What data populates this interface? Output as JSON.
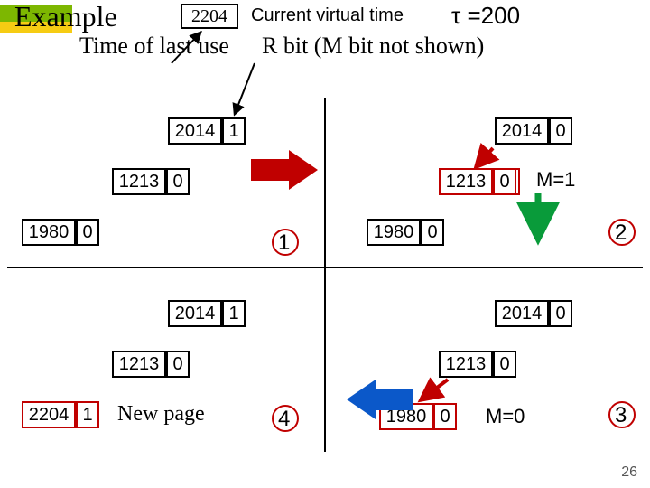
{
  "header": {
    "title": "Example",
    "box_value": "2204",
    "current_virtual_time": "Current virtual time",
    "tau": "τ =200",
    "time_of_last_use": "Time of last use",
    "r_bit": "R bit  (M bit not shown)"
  },
  "panels": {
    "p1": {
      "num": "1",
      "entries": [
        {
          "v": "2014",
          "b": "1"
        },
        {
          "v": "1213",
          "b": "0"
        },
        {
          "v": "1980",
          "b": "0"
        }
      ]
    },
    "p2": {
      "num": "2",
      "m": "M=1",
      "entries": [
        {
          "v": "2014",
          "b": "0"
        },
        {
          "v": "1213",
          "b": "0"
        },
        {
          "v": "1980",
          "b": "0"
        }
      ]
    },
    "p3": {
      "num": "3",
      "m": "M=0",
      "entries": [
        {
          "v": "2014",
          "b": "0"
        },
        {
          "v": "1213",
          "b": "0"
        },
        {
          "v": "1980",
          "b": "0"
        }
      ]
    },
    "p4": {
      "num": "4",
      "new_page": "New page",
      "entries": [
        {
          "v": "2014",
          "b": "1"
        },
        {
          "v": "1213",
          "b": "0"
        },
        {
          "v": "2204",
          "b": "1"
        }
      ]
    }
  },
  "page_number": "26"
}
